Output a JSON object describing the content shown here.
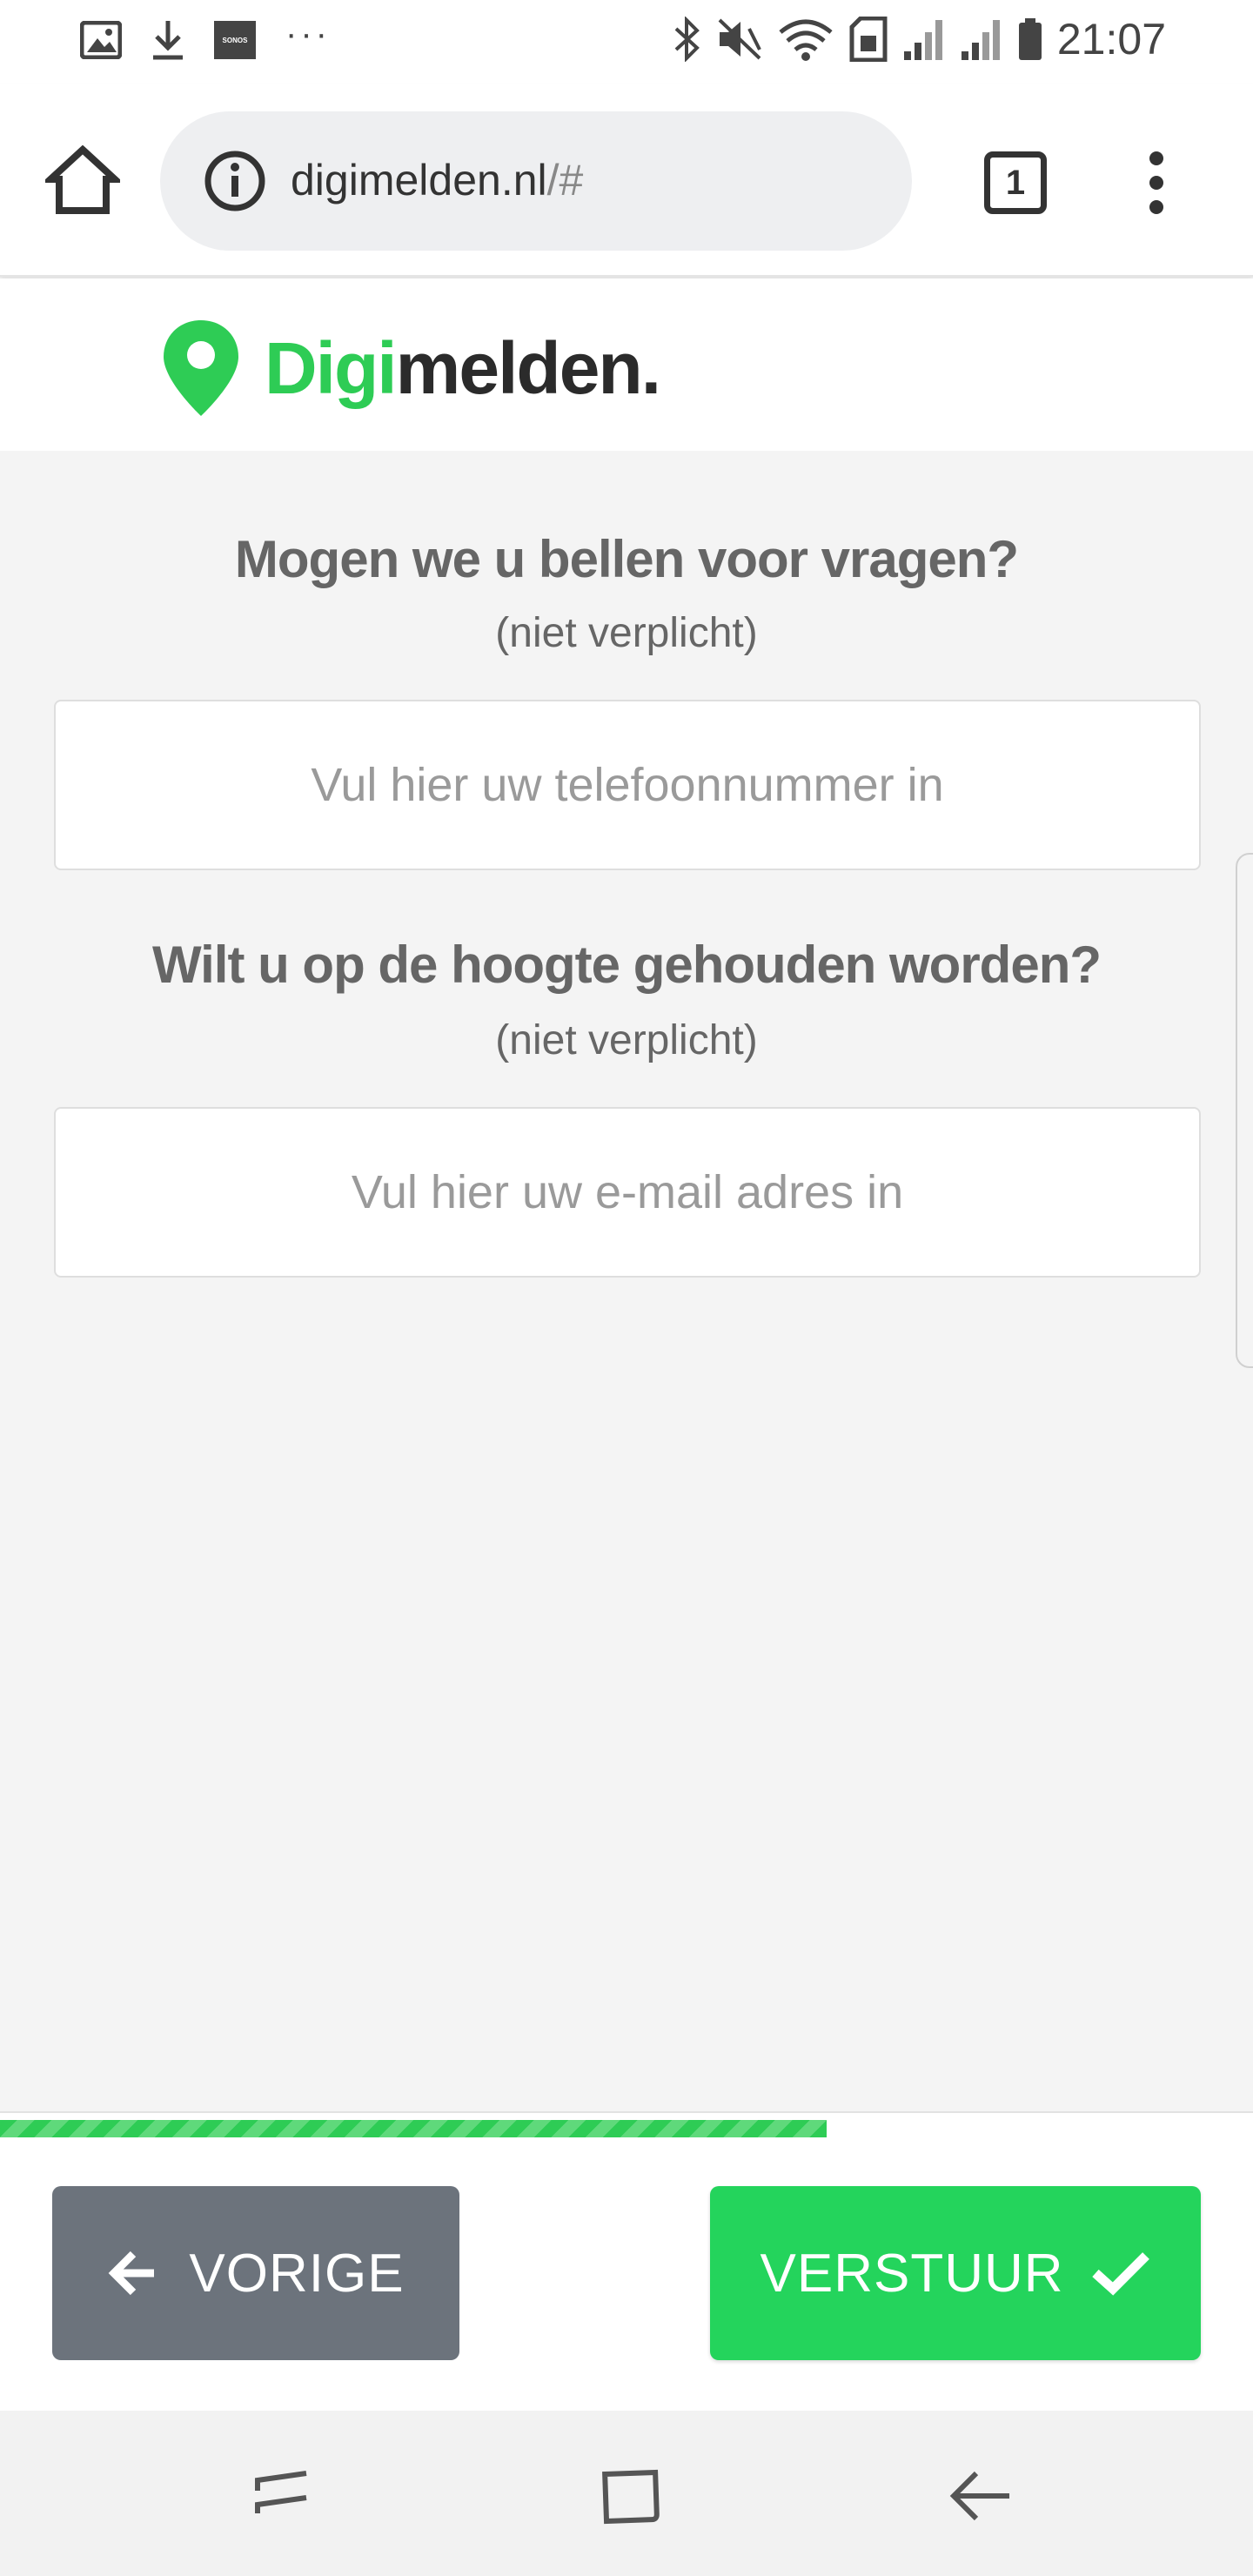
{
  "status_bar": {
    "time": "21:07",
    "left_icons": [
      "image-icon",
      "download-icon",
      "sonos-icon",
      "more-notifications-icon"
    ],
    "sonos_label": "SONOS",
    "right_icons": [
      "bluetooth-icon",
      "mute-icon",
      "wifi-icon",
      "sim-icon",
      "signal-icon",
      "signal-icon",
      "battery-icon"
    ]
  },
  "browser": {
    "url_domain": "digimelden.nl",
    "url_path": "/#",
    "tab_count": "1"
  },
  "header": {
    "logo_green": "Digi",
    "logo_dark": "melden.",
    "logo_color": "#2ecc55"
  },
  "form": {
    "phone_question": "Mogen we u bellen voor vragen?",
    "phone_optional": "(niet verplicht)",
    "phone_placeholder": "Vul hier uw telefoonnummer in",
    "email_question": "Wilt u op de hoogte gehouden worden?",
    "email_optional": "(niet verplicht)",
    "email_placeholder": "Vul hier uw e-mail adres in"
  },
  "footer": {
    "progress_percent": 66,
    "prev_label": "VORIGE",
    "send_label": "VERSTUUR",
    "prev_color": "#6c737c",
    "send_color": "#24d45c"
  },
  "nav_bar": {
    "icons": [
      "recent-apps-icon",
      "home-button-icon",
      "back-icon"
    ]
  }
}
